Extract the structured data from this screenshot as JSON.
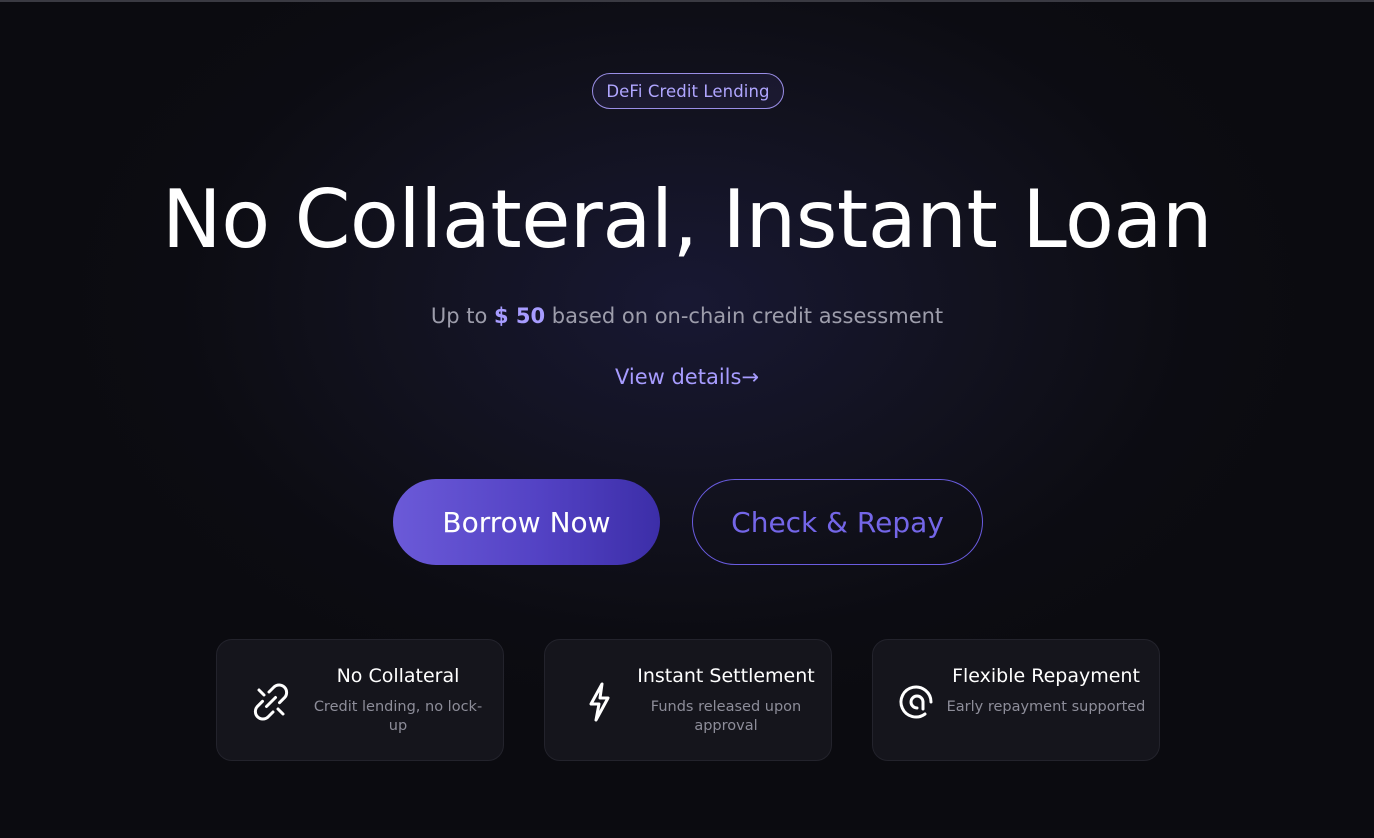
{
  "hero": {
    "badge": "DeFi Credit Lending",
    "title": "No Collateral, Instant Loan",
    "subtitle_prefix": "Up to ",
    "subtitle_amount": "$ 50",
    "subtitle_suffix": " based on on-chain credit assessment",
    "details_link": "View details",
    "details_arrow": "→"
  },
  "actions": {
    "borrow_label": "Borrow Now",
    "repay_label": "Check & Repay"
  },
  "features": [
    {
      "icon": "broken-link-icon",
      "title": "No Collateral",
      "description": "Credit lending, no lock-up"
    },
    {
      "icon": "lightning-icon",
      "title": "Instant Settlement",
      "description": "Funds released upon approval"
    },
    {
      "icon": "refresh-circle-icon",
      "title": "Flexible Repayment",
      "description": "Early repayment supported"
    }
  ],
  "colors": {
    "accent": "#a79cff",
    "primary_button": "#5342c4",
    "background": "#0b0b10"
  }
}
